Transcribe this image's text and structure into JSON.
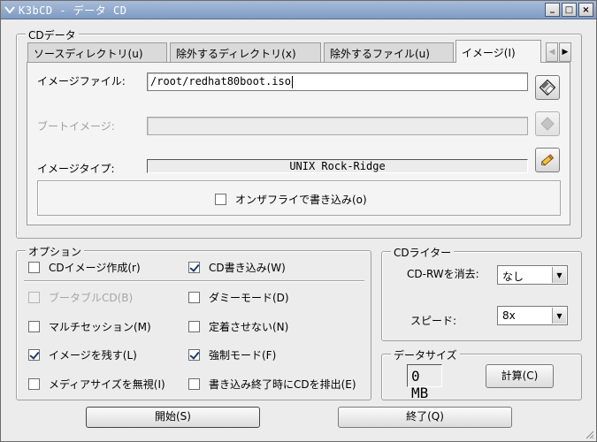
{
  "window": {
    "title": "K3bCD - データ CD",
    "minimize": "_",
    "maximize": "□",
    "close": "×"
  },
  "cd_data_group": {
    "title": "CDデータ"
  },
  "tabs": [
    {
      "label": "ソースディレクトリ(u)",
      "active": false
    },
    {
      "label": "除外するディレクトリ(x)",
      "active": false
    },
    {
      "label": "除外するファイル(u)",
      "active": false
    },
    {
      "label": "イメージ(I)",
      "active": true
    }
  ],
  "image_tab": {
    "image_file_label": "イメージファイル:",
    "image_file_value": "/root/redhat80boot.iso",
    "boot_image_label": "ブートイメージ:",
    "boot_image_value": "",
    "image_type_label": "イメージタイプ:",
    "image_type_value": "UNIX Rock-Ridge",
    "on_the_fly_label": "オンザフライで書き込み(o)",
    "on_the_fly_checked": false
  },
  "options": {
    "title": "オプション",
    "left": [
      {
        "label": "CDイメージ作成(r)",
        "checked": false,
        "disabled": false
      },
      {
        "label": "ブータブルCD(B)",
        "checked": false,
        "disabled": true
      },
      {
        "label": "マルチセッション(M)",
        "checked": false,
        "disabled": false
      },
      {
        "label": "イメージを残す(L)",
        "checked": true,
        "disabled": false
      },
      {
        "label": "メディアサイズを無視(I)",
        "checked": false,
        "disabled": false
      }
    ],
    "right": [
      {
        "label": "CD書き込み(W)",
        "checked": true,
        "disabled": false
      },
      {
        "label": "ダミーモード(D)",
        "checked": false,
        "disabled": false
      },
      {
        "label": "定着させない(N)",
        "checked": false,
        "disabled": false
      },
      {
        "label": "強制モード(F)",
        "checked": true,
        "disabled": false
      },
      {
        "label": "書き込み終了時にCDを排出(E)",
        "checked": false,
        "disabled": false
      }
    ]
  },
  "cd_writer": {
    "title": "CDライター",
    "erase_label": "CD-RWを消去:",
    "erase_value": "なし",
    "speed_label": "スピード:",
    "speed_value": "8x"
  },
  "data_size": {
    "title": "データサイズ",
    "value": "0 MB",
    "calc_button": "計算(C)"
  },
  "actions": {
    "start": "開始(S)",
    "quit": "終了(Q)"
  },
  "icons": {
    "browse": "floppy-disk-icon",
    "boot": "diamond-icon",
    "type": "pencil-icon"
  }
}
